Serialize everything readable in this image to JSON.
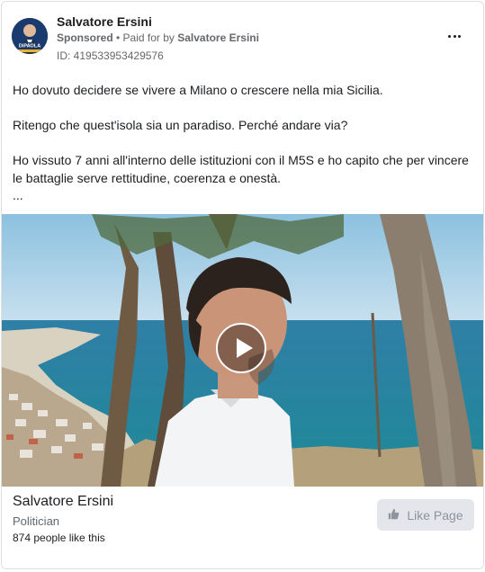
{
  "ad": {
    "page_name": "Salvatore Ersini",
    "sponsored_label": "Sponsored",
    "separator": " • ",
    "paid_for_prefix": "Paid for by ",
    "paid_for_by": "Salvatore Ersini",
    "ad_id": "ID: 419533953429576",
    "avatar_text": "DiPAOLA",
    "more_icon": "more-horizontal-icon"
  },
  "body": {
    "line1": "Ho dovuto decidere se vivere a Milano o crescere nella mia Sicilia.",
    "line2": "Ritengo che quest'isola sia un paradiso. Perché andare via?",
    "line3": "Ho vissuto 7 anni all'interno delle istituzioni con il M5S e ho capito che per vincere le battaglie serve rettitudine, coerenza e onestà.",
    "ellipsis": "..."
  },
  "media": {
    "type": "video",
    "play_icon": "play-icon"
  },
  "footer": {
    "name": "Salvatore Ersini",
    "category": "Politician",
    "likes": "874 people like this",
    "like_button_label": "Like Page",
    "like_icon": "thumbs-up-icon"
  },
  "colors": {
    "text": "#1c1e21",
    "secondary": "#65676b",
    "button_bg": "#e4e6eb",
    "button_text": "#8d949e",
    "border": "#dddfe2"
  }
}
